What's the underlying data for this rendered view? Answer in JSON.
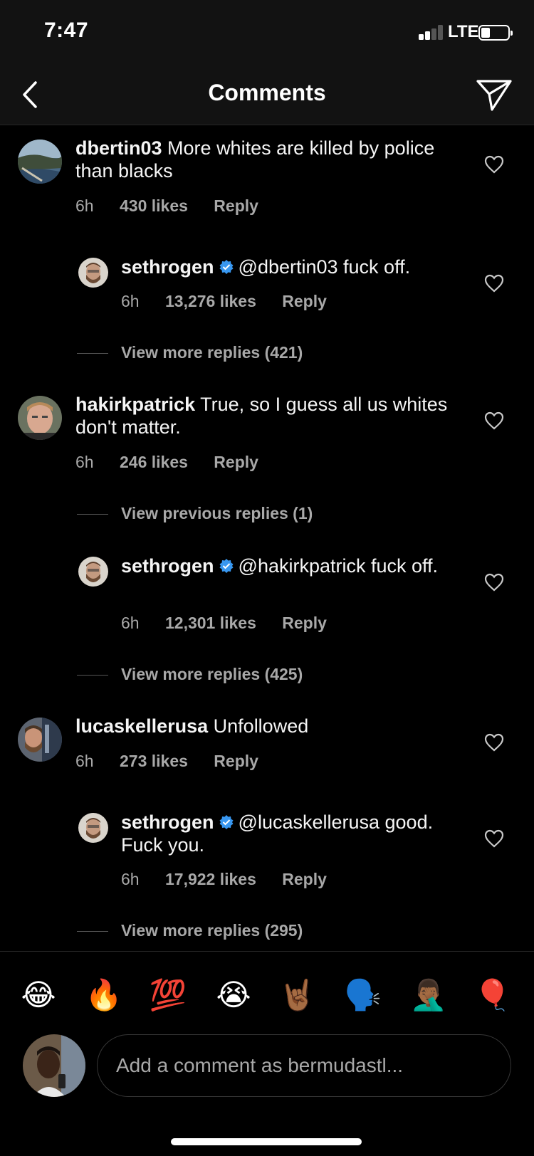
{
  "status_bar": {
    "time": "7:47",
    "network": "LTE",
    "signal_bars_active": 2,
    "signal_bars_total": 4,
    "battery_level": 0.25
  },
  "nav": {
    "title": "Comments",
    "back_icon": "chevron-left-icon",
    "send_icon": "paper-plane-icon"
  },
  "colors": {
    "background": "#000000",
    "header": "#121212",
    "secondary_text": "#a8a8a8",
    "verified": "#3897f0"
  },
  "comments": [
    {
      "username": "dbertin03",
      "text": "More whites are killed by police than blacks",
      "time": "6h",
      "likes": "430 likes",
      "reply_label": "Reply",
      "reply": {
        "username": "sethrogen",
        "verified": true,
        "text": "@dbertin03 fuck off.",
        "time": "6h",
        "likes": "13,276 likes",
        "reply_label": "Reply"
      },
      "view_more": "View more replies (421)"
    },
    {
      "username": "hakirkpatrick",
      "text": "True, so I guess all us whites don't matter.",
      "time": "6h",
      "likes": "246 likes",
      "reply_label": "Reply",
      "view_previous": "View previous replies (1)",
      "reply": {
        "username": "sethrogen",
        "verified": true,
        "text": "@hakirkpatrick fuck off.",
        "time": "6h",
        "likes": "12,301 likes",
        "reply_label": "Reply"
      },
      "view_more": "View more replies (425)"
    },
    {
      "username": "lucaskellerusa",
      "text": "Unfollowed",
      "time": "6h",
      "likes": "273 likes",
      "reply_label": "Reply",
      "reply": {
        "username": "sethrogen",
        "verified": true,
        "text": "@lucaskellerusa good. Fuck you.",
        "time": "6h",
        "likes": "17,922 likes",
        "reply_label": "Reply"
      },
      "view_more": "View more replies (295)"
    }
  ],
  "emoji_bar": [
    "😂",
    "🔥",
    "💯",
    "😭",
    "🤘🏾",
    "🗣️",
    "🤦🏾‍♂️",
    "🎈"
  ],
  "composer": {
    "placeholder": "Add a comment as bermudastl..."
  }
}
